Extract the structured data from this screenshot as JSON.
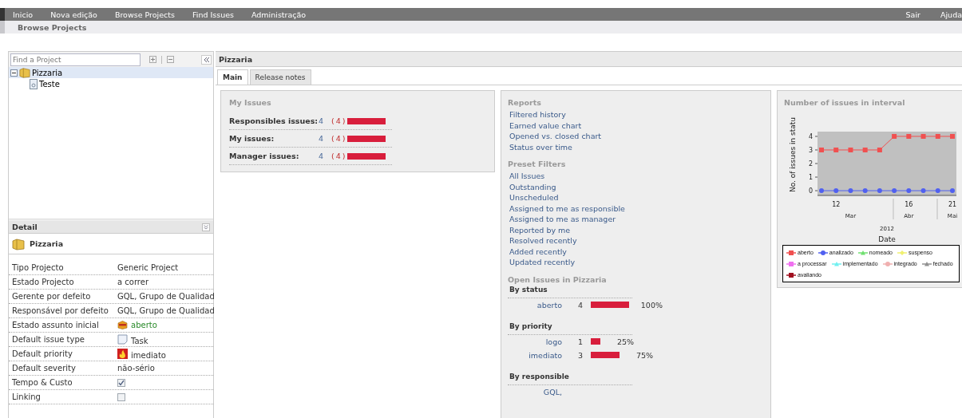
{
  "top_menu": {
    "left": [
      "Inicio",
      "Nova edição",
      "Browse Projects",
      "Find Issues",
      "Administração"
    ],
    "right": [
      "Sair",
      "Ajuda"
    ]
  },
  "breadcrumb": "Browse Projects",
  "project_tree": {
    "search": {
      "placeholder": "Find a Project"
    },
    "items": [
      {
        "label": "Pizzaria",
        "selected": true,
        "expanded": true,
        "children": [
          {
            "label": "Teste",
            "selected": false
          }
        ]
      }
    ]
  },
  "detail": {
    "title": "Detail",
    "project": "Pizzaria",
    "rows": [
      {
        "label": "Tipo Projecto",
        "kind": "text",
        "value": "Generic Project"
      },
      {
        "label": "Estado Projecto",
        "kind": "text",
        "value": "a correr"
      },
      {
        "label": "Gerente por defeito",
        "kind": "text",
        "value": "GQL, Grupo de Qualidad"
      },
      {
        "label": "Responsável por defeito",
        "kind": "text",
        "value": "GQL, Grupo de Qualidad"
      },
      {
        "label": "Estado assunto inicial",
        "kind": "status",
        "value": "aberto"
      },
      {
        "label": "Default issue type",
        "kind": "task",
        "value": "Task"
      },
      {
        "label": "Default priority",
        "kind": "priority",
        "value": "imediato"
      },
      {
        "label": "Default severity",
        "kind": "text",
        "value": "não-sério"
      },
      {
        "label": "Tempo & Custo",
        "kind": "checkbox",
        "checked": true
      },
      {
        "label": "Linking",
        "kind": "checkbox",
        "checked": false
      }
    ]
  },
  "project_title": "Pizzaria",
  "tabs": [
    {
      "label": "Main",
      "selected": true
    },
    {
      "label": "Release notes",
      "selected": false
    }
  ],
  "my_issues": {
    "title": "My Issues",
    "rows": [
      {
        "label": "Responsibles issues:",
        "count": "4",
        "open": "(4)"
      },
      {
        "label": "My issues:",
        "count": "4",
        "open": "(4)"
      },
      {
        "label": "Manager issues:",
        "count": "4",
        "open": "(4)"
      }
    ]
  },
  "reports": {
    "title": "Reports",
    "links": [
      "Filtered history",
      "Earned value chart",
      "Opened vs. closed chart",
      "Status over time"
    ]
  },
  "preset_filters": {
    "title": "Preset Filters",
    "links": [
      "All Issues",
      "Outstanding",
      "Unscheduled",
      "Assigned to me as responsible",
      "Assigned to me as manager",
      "Reported by me",
      "Resolved recently",
      "Added recently",
      "Updated recently"
    ]
  },
  "open_issues": {
    "title": "Open Issues in Pizzaria",
    "groups": [
      {
        "title": "By status",
        "rows": [
          {
            "label": "aberto",
            "count": "4",
            "percent": "100%"
          }
        ]
      },
      {
        "title": "By priority",
        "rows": [
          {
            "label": "logo",
            "count": "1",
            "percent": "25%"
          },
          {
            "label": "imediato",
            "count": "3",
            "percent": "75%"
          }
        ]
      },
      {
        "title": "By responsible",
        "rows": [
          {
            "label": "GQL,"
          }
        ]
      }
    ]
  },
  "chart_panel": {
    "title": "Number of issues in interval",
    "months": [
      "Mar",
      "Abr",
      "Mai"
    ],
    "year": "2012",
    "chart_data": {
      "type": "line",
      "xlabel": "Date",
      "ylabel": "No. of issues in statu",
      "categories": [
        null,
        "12",
        null,
        null,
        null,
        null,
        "16",
        null,
        null,
        "21"
      ],
      "ylim": [
        -0.35,
        4.35
      ],
      "yticks": [
        0,
        1,
        2,
        3,
        4
      ],
      "legend": "bottom",
      "series": [
        {
          "name": "aberto",
          "color": "#f05050",
          "marker": "square",
          "values": [
            3,
            3,
            3,
            3,
            3,
            4,
            4,
            4,
            4,
            4
          ]
        },
        {
          "name": "analizado",
          "color": "#5060f0",
          "marker": "circle",
          "values": [
            0,
            0,
            0,
            0,
            0,
            0,
            0,
            0,
            0,
            0
          ]
        },
        {
          "name": "nomeado",
          "color": "#70e070",
          "marker": "triangle",
          "values": [
            null,
            null,
            null,
            null,
            null,
            null,
            null,
            null,
            null,
            null
          ]
        },
        {
          "name": "suspenso",
          "color": "#f0f070",
          "marker": "diamond",
          "values": [
            null,
            null,
            null,
            null,
            null,
            null,
            null,
            null,
            null,
            null
          ]
        },
        {
          "name": "a processar",
          "color": "#f070f0",
          "marker": "square",
          "values": [
            null,
            null,
            null,
            null,
            null,
            null,
            null,
            null,
            null,
            null
          ]
        },
        {
          "name": "implementado",
          "color": "#70f0f0",
          "marker": "triangle",
          "values": [
            null,
            null,
            null,
            null,
            null,
            null,
            null,
            null,
            null,
            null
          ]
        },
        {
          "name": "integrado",
          "color": "#f0b0b0",
          "marker": "circle",
          "values": [
            null,
            null,
            null,
            null,
            null,
            null,
            null,
            null,
            null,
            null
          ]
        },
        {
          "name": "fechado",
          "color": "#909090",
          "marker": "triangle",
          "values": [
            null,
            null,
            null,
            null,
            null,
            null,
            null,
            null,
            null,
            null
          ]
        },
        {
          "name": "avaliando",
          "color": "#a01020",
          "marker": "square",
          "values": [
            null,
            null,
            null,
            null,
            null,
            null,
            null,
            null,
            null,
            null
          ]
        }
      ]
    }
  }
}
